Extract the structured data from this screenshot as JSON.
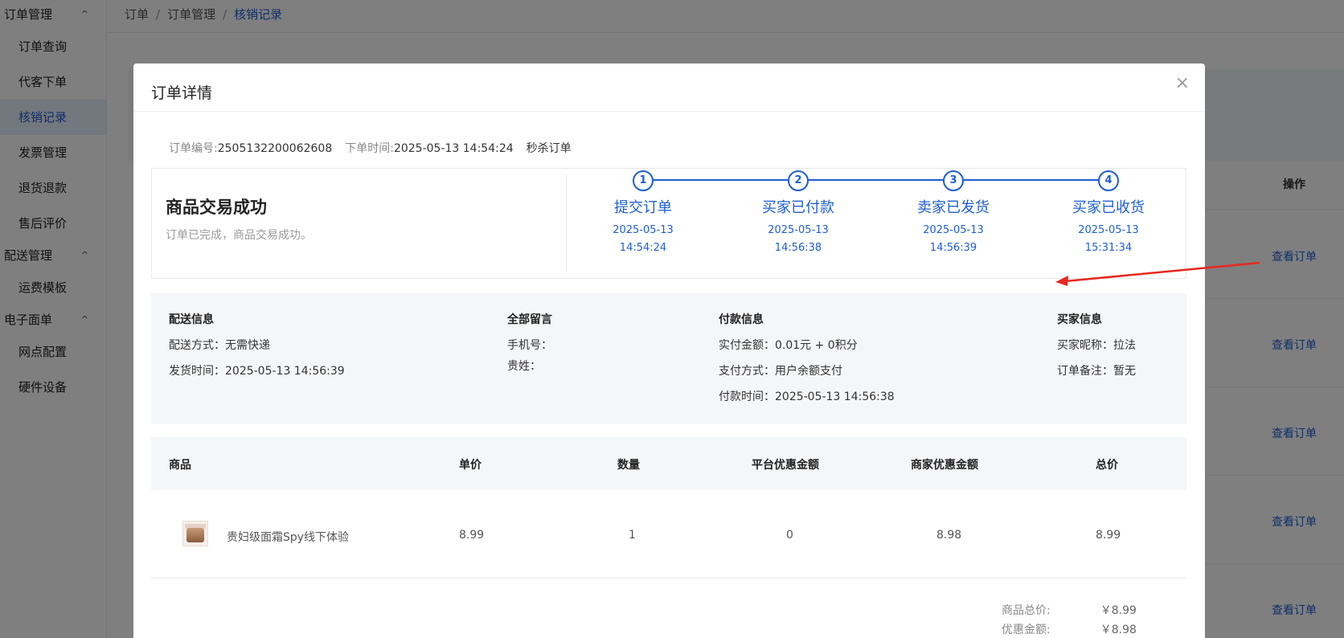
{
  "sidebar": {
    "groups": [
      {
        "label": "订单管理",
        "items": [
          "订单查询",
          "代客下单",
          "核销记录",
          "发票管理",
          "退货退款",
          "售后评价"
        ]
      },
      {
        "label": "配送管理",
        "items": [
          "运费模板"
        ]
      },
      {
        "label": "电子面单",
        "items": [
          "网点配置",
          "硬件设备"
        ]
      }
    ],
    "active": "核销记录",
    "chevron": "^"
  },
  "breadcrumb": [
    "订单",
    "订单管理",
    "核销记录"
  ],
  "breadcrumb_sep": "/",
  "background_table": {
    "op_header": "操作",
    "view_label": "查看订单"
  },
  "modal": {
    "title": "订单详情",
    "close": "×",
    "meta": {
      "order_no_label": "订单编号:",
      "order_no": "2505132200062608",
      "order_time_label": "下单时间:",
      "order_time": "2025-05-13 14:54:24",
      "order_type": "秒杀订单"
    },
    "status": {
      "title": "商品交易成功",
      "desc": "订单已完成，商品交易成功。"
    },
    "steps": [
      {
        "num": "1",
        "label": "提交订单",
        "date": "2025-05-13",
        "time": "14:54:24"
      },
      {
        "num": "2",
        "label": "买家已付款",
        "date": "2025-05-13",
        "time": "14:56:38"
      },
      {
        "num": "3",
        "label": "卖家已发货",
        "date": "2025-05-13",
        "time": "14:56:39"
      },
      {
        "num": "4",
        "label": "买家已收货",
        "date": "2025-05-13",
        "time": "15:31:34"
      }
    ],
    "info": {
      "delivery": {
        "title": "配送信息",
        "method": "配送方式：无需快递",
        "ship_time": "发货时间：2025-05-13 14:56:39"
      },
      "remarks": {
        "title": "全部留言",
        "phone": "手机号：",
        "surname": "贵姓："
      },
      "payment": {
        "title": "付款信息",
        "amount": "实付金额：0.01元 + 0积分",
        "method": "支付方式：用户余额支付",
        "time": "付款时间：2025-05-13 14:56:38"
      },
      "buyer": {
        "title": "买家信息",
        "nickname": "买家昵称：拉法",
        "note": "订单备注：暂无"
      }
    },
    "goods_table": {
      "headers": [
        "商品",
        "单价",
        "数量",
        "平台优惠金额",
        "商家优惠金额",
        "总价"
      ],
      "rows": [
        {
          "name": "贵妇级面霜Spy线下体验",
          "price": "8.99",
          "qty": "1",
          "platform_discount": "0",
          "merchant_discount": "8.98",
          "total": "8.99"
        }
      ]
    },
    "totals": [
      {
        "label": "商品总价:",
        "value": "￥8.99"
      },
      {
        "label": "优惠金额:",
        "value": "￥8.98"
      }
    ]
  },
  "colors": {
    "accent": "#1e5fd0",
    "arrow": "#e8281e"
  }
}
